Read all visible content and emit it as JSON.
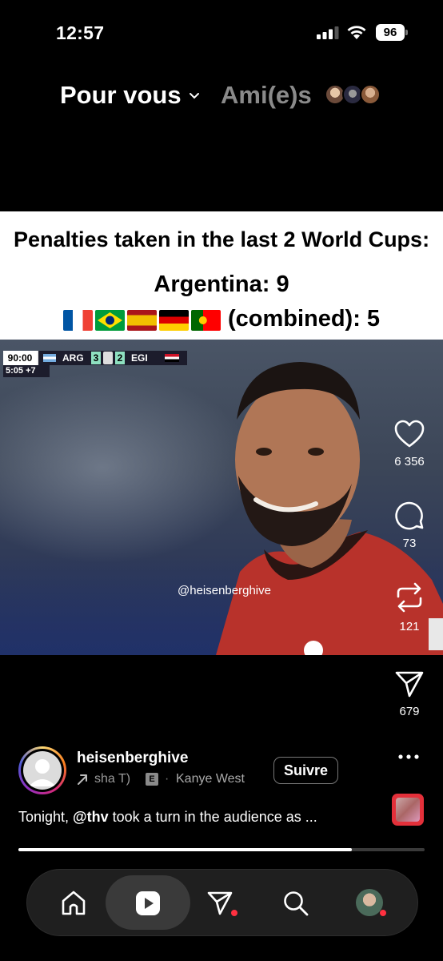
{
  "status_bar": {
    "time": "12:57",
    "battery": "96"
  },
  "feed_tabs": {
    "for_you": "Pour vous",
    "friends": "Ami(e)s"
  },
  "post": {
    "caption_card": {
      "headline": "Penalties taken in the last 2 World Cups:",
      "line2": "Argentina: 9",
      "line3": "(combined): 5",
      "flags": [
        "France",
        "Brazil",
        "Spain",
        "Germany",
        "Portugal"
      ]
    },
    "scoreboard": {
      "time": "90:00",
      "home": "ARG",
      "home_score": "3",
      "away_score": "2",
      "away": "EGI",
      "added_time": "5:05 +7"
    },
    "watermark": "@heisenberghive",
    "actions": {
      "likes": "6 356",
      "comments": "73",
      "reposts": "121",
      "shares": "679"
    },
    "author": {
      "username": "heisenberghive",
      "music_fragment": "sha T)",
      "explicit": "E",
      "music_separator": "·",
      "music_artist": "Kanye West"
    },
    "follow_label": "Suivre",
    "caption_prefix": "Tonight, ",
    "caption_mention": "@thv",
    "caption_suffix": " took a turn in the audience as ...",
    "progress_percent": 82
  },
  "colors": {
    "accent_red": "#ff3040",
    "background": "#000000"
  },
  "icons": [
    "signal-icon",
    "wifi-icon",
    "heart-icon",
    "comment-icon",
    "repost-icon",
    "send-icon",
    "more-icon",
    "home-icon",
    "reels-icon",
    "search-icon"
  ]
}
